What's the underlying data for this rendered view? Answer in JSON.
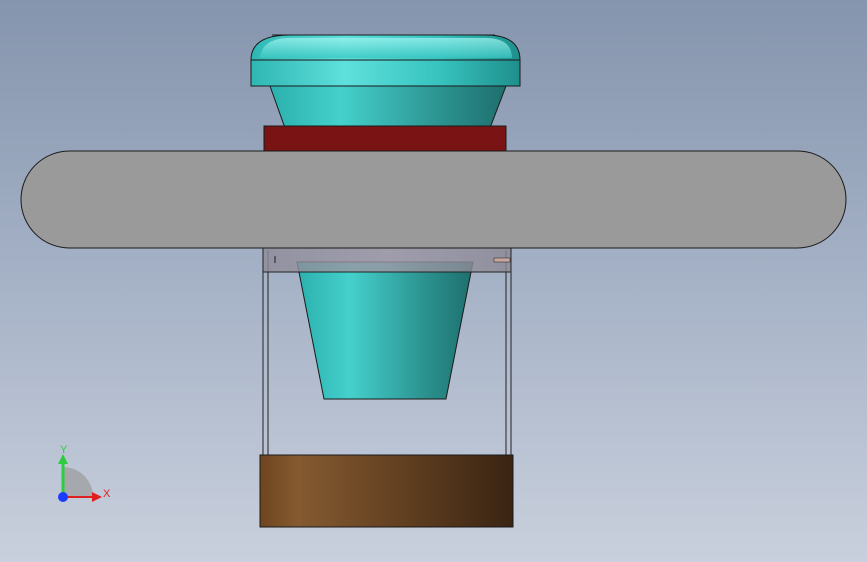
{
  "viewport": {
    "colors": {
      "background_top": "#8595ad",
      "background_bottom": "#c9d0dd",
      "cone_cyan": "#36c4c0",
      "flange_dark_red": "#7a1414",
      "wheel_gray": "#9a9a9a",
      "base_brown": "#7a4f2a"
    }
  },
  "triad": {
    "y_label": "Y",
    "x_label": "X",
    "colors": {
      "y": "#2ecc40",
      "x": "#e02020",
      "z": "#1a3cff"
    }
  }
}
